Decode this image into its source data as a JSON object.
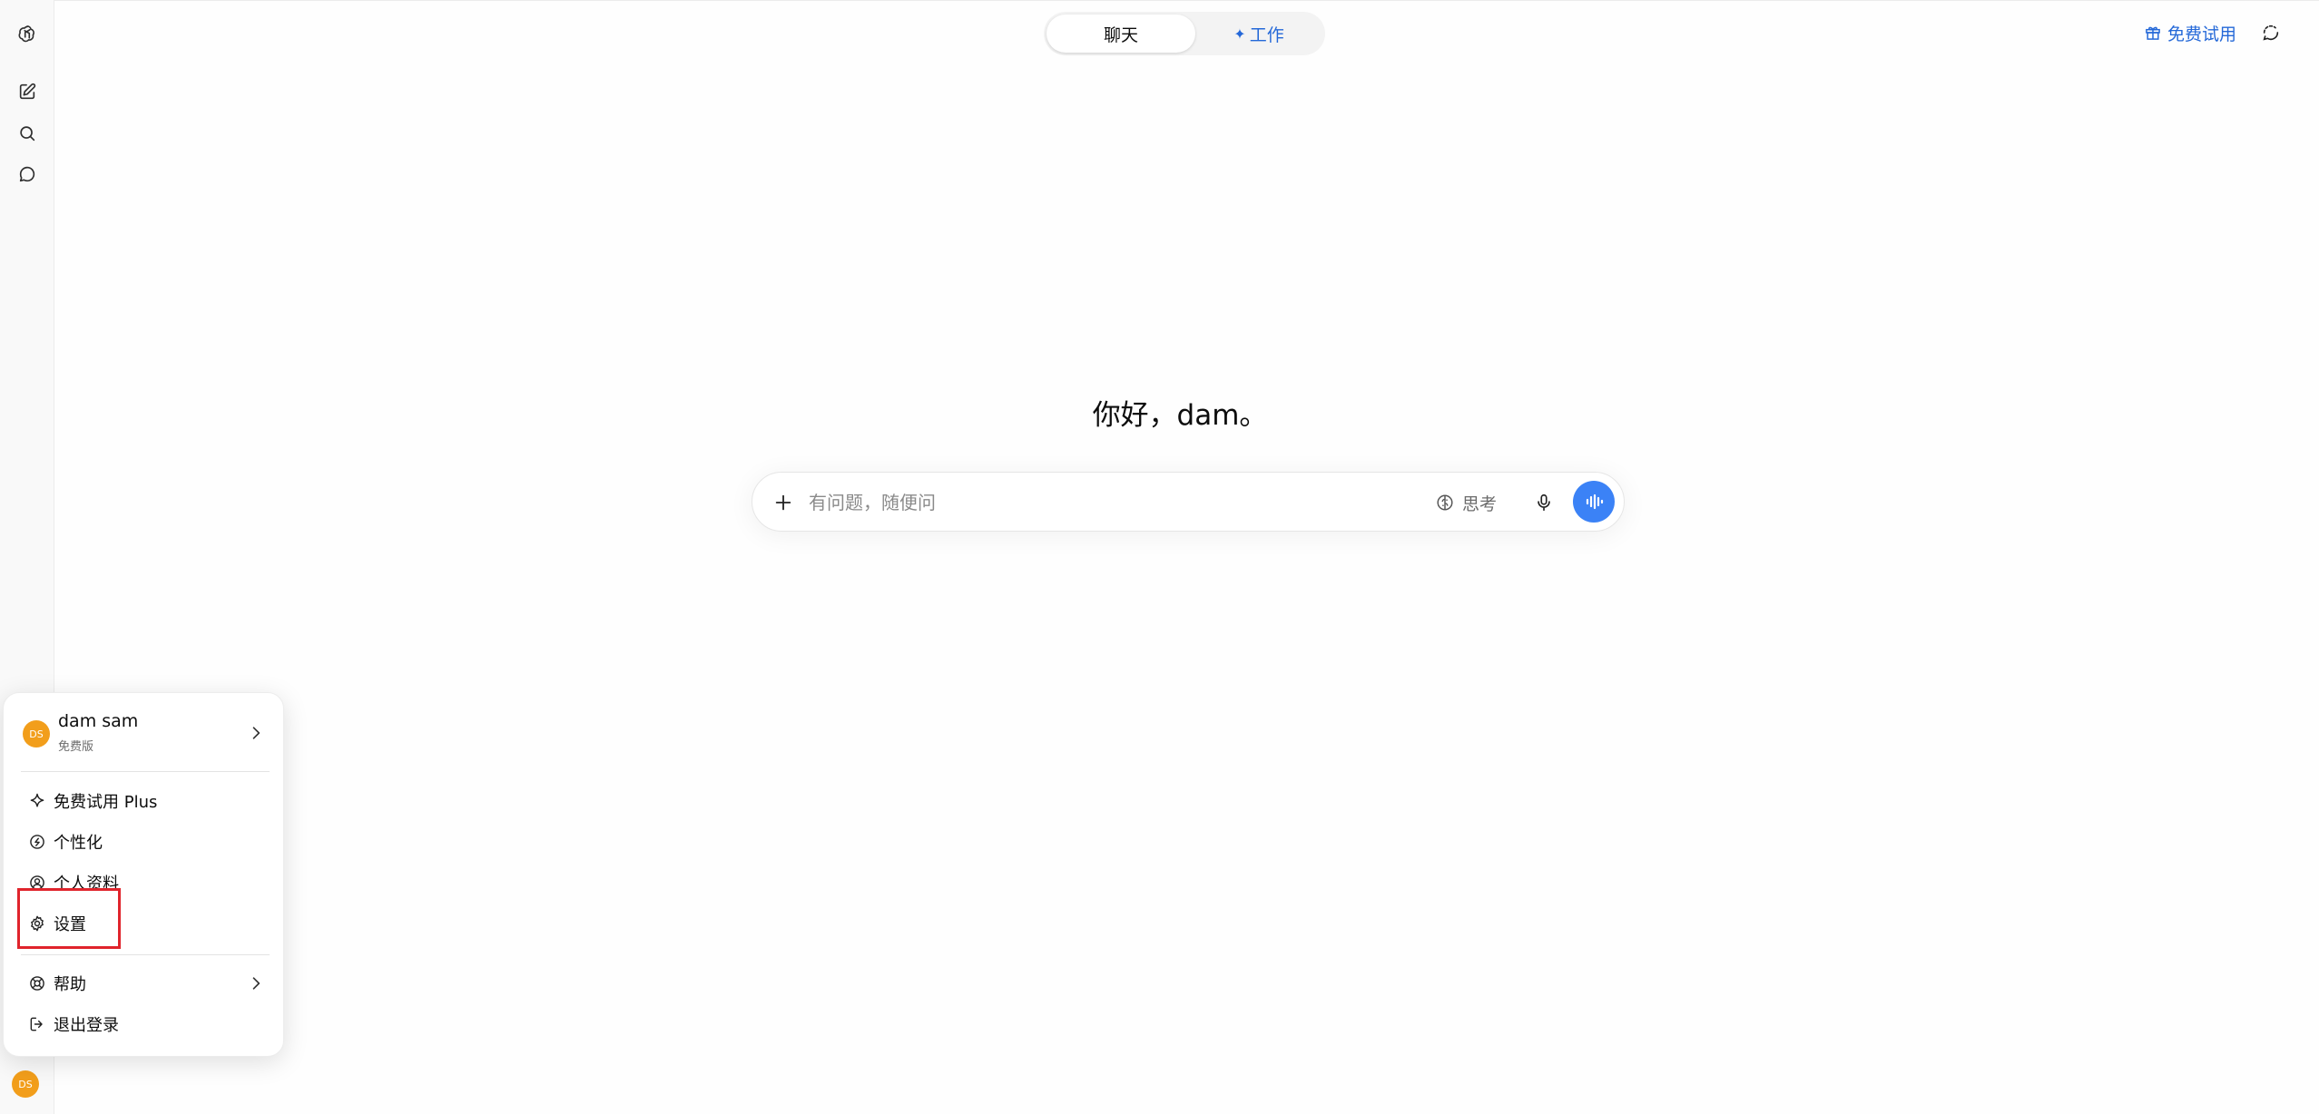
{
  "mode_toggle": {
    "chat_label": "聊天",
    "work_label": "工作",
    "work_icon": "sparkle-icon"
  },
  "topbar": {
    "trial_label": "免费试用",
    "trial_icon": "gift-icon"
  },
  "greeting": "你好，dam。",
  "composer": {
    "placeholder": "有问题，随便问",
    "think_label": "思考",
    "voice_color": "#3b82f6"
  },
  "menu": {
    "user": {
      "name": "dam sam",
      "plan": "免费版",
      "initials": "DS"
    },
    "items": [
      {
        "label": "免费试用 Plus",
        "icon": "sparkle-icon"
      },
      {
        "label": "个性化",
        "icon": "personalize-icon"
      },
      {
        "label": "个人资料",
        "icon": "profile-icon"
      },
      {
        "label": "设置",
        "icon": "gear-icon"
      },
      {
        "label": "帮助",
        "icon": "lifebuoy-icon"
      },
      {
        "label": "退出登录",
        "icon": "logout-icon"
      }
    ]
  },
  "rail": {
    "avatar_initials": "DS"
  },
  "colors": {
    "accent": "#2468d8",
    "avatar": "#f29e1b",
    "highlight": "#e0242c"
  }
}
